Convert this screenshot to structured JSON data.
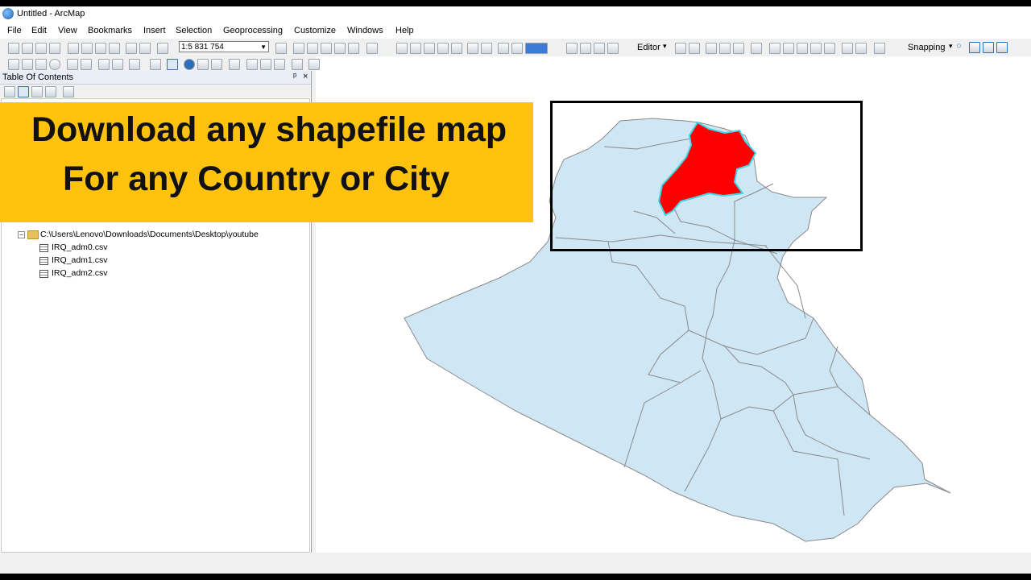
{
  "window": {
    "title": "Untitled - ArcMap"
  },
  "menu": [
    "File",
    "Edit",
    "View",
    "Bookmarks",
    "Insert",
    "Selection",
    "Geoprocessing",
    "Customize",
    "Windows",
    "Help"
  ],
  "toolbar": {
    "scale_value": "1:5 831 754",
    "editor_label": "Editor",
    "snapping_label": "Snapping"
  },
  "toc": {
    "title": "Table Of Contents",
    "pin": "ᵖ",
    "close": "×",
    "folder_path": "C:\\Users\\Lenovo\\Downloads\\Documents\\Desktop\\youtube",
    "files": [
      "IRQ_adm0.csv",
      "IRQ_adm1.csv",
      "IRQ_adm2.csv"
    ]
  },
  "banner": {
    "line1": "Download any shapefile map",
    "line2": "For any Country or City"
  },
  "map": {
    "land_color": "#cfe6f5",
    "border_color": "#8a8a8a",
    "selected_color": "#ff0000",
    "selection_outline": "#3fd6e6"
  }
}
